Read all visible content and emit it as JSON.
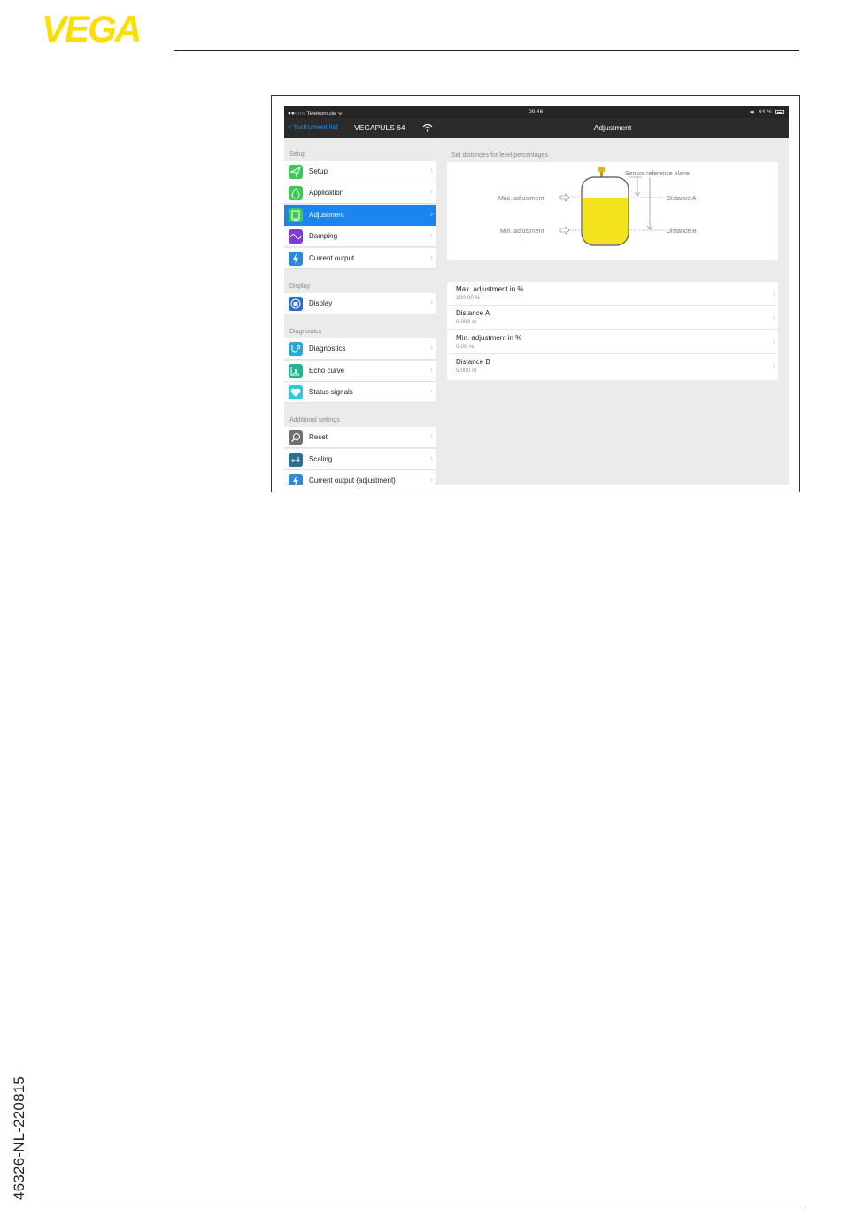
{
  "brand": {
    "logo_text": "VEGA",
    "logo_color": "#fede00",
    "document_code": "46326-NL-220815"
  },
  "statusbar": {
    "carrier": "●●○○○ Telekom.de ᯤ",
    "time": "09:46",
    "bluetooth": "✱",
    "battery": "64 %"
  },
  "navbar": {
    "back_label": "< Instrument list",
    "device": "VEGAPULS 64",
    "title": "Adjustment",
    "accent": "#1e8ff3"
  },
  "sidebar": {
    "sections": [
      {
        "header": "Setup",
        "items": [
          {
            "label": "Setup",
            "icon": "paper-plane-icon",
            "color": "#3cc954"
          },
          {
            "label": "Application",
            "icon": "tank-drop-icon",
            "color": "#3cc954"
          },
          {
            "label": "Adjustment",
            "icon": "screen-icon",
            "color": "#3cc954",
            "active": true
          },
          {
            "label": "Damping",
            "icon": "wave-icon",
            "color": "#7f3bd6"
          },
          {
            "label": "Current output",
            "icon": "lightning-icon",
            "color": "#2c8bd8"
          }
        ]
      },
      {
        "header": "Display",
        "items": [
          {
            "label": "Display",
            "icon": "display-icon",
            "color": "#2c6bd0"
          }
        ]
      },
      {
        "header": "Diagnostics",
        "items": [
          {
            "label": "Diagnostics",
            "icon": "stethoscope-icon",
            "color": "#28a8d8"
          },
          {
            "label": "Echo curve",
            "icon": "echo-curve-icon",
            "color": "#1fb48d"
          },
          {
            "label": "Status signals",
            "icon": "heart-icon",
            "color": "#2fc8d8"
          }
        ]
      },
      {
        "header": "Additional settings",
        "items": [
          {
            "label": "Reset",
            "icon": "reset-icon",
            "color": "#707070"
          },
          {
            "label": "Scaling",
            "icon": "scaling-icon",
            "color": "#2d6f8e"
          },
          {
            "label": "Current output (adjustment)",
            "icon": "lightning-icon",
            "color": "#2c8bd8"
          }
        ]
      }
    ]
  },
  "content": {
    "caption": "Set distances for level percentages",
    "diagram": {
      "sensor_reference_plane": "Sensor reference plane",
      "max_adjustment": "Max. adjustment",
      "min_adjustment": "Min. adjustment",
      "distance_a": "Distance A",
      "distance_b": "Distance B",
      "fill_color": "#f4e21f",
      "sensor_color": "#d8b81a"
    },
    "settings": [
      {
        "title": "Max. adjustment in %",
        "value": "100.00 %"
      },
      {
        "title": "Distance A",
        "value": "0.000 m"
      },
      {
        "title": "Min. adjustment in %",
        "value": "0.00 %"
      },
      {
        "title": "Distance B",
        "value": "5.000 m"
      }
    ]
  }
}
